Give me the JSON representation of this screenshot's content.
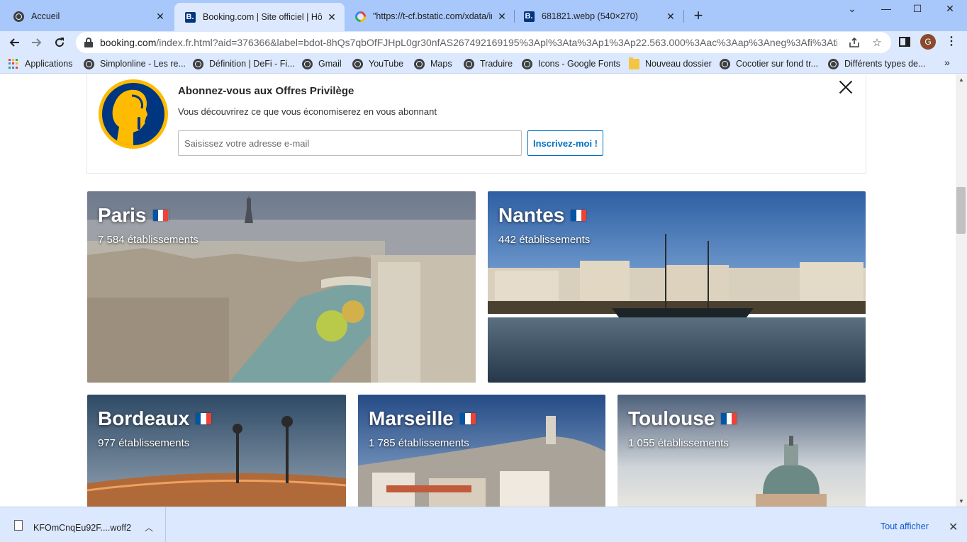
{
  "browser": {
    "tabs": [
      {
        "title": "Accueil",
        "favicon": "globe-icon"
      },
      {
        "title": "Booking.com | Site officiel | Hôtel",
        "favicon": "booking-icon"
      },
      {
        "title": "\"https://t-cf.bstatic.com/xdata/im",
        "favicon": "google-icon"
      },
      {
        "title": "681821.webp (540×270)",
        "favicon": "booking-icon"
      }
    ],
    "new_tab": "+",
    "window_controls": {
      "minimize": "—",
      "maximize": "☐",
      "close": "✕",
      "tab_search": "⌄"
    },
    "url_host": "booking.com",
    "url_rest": "/index.fr.html?aid=376366&label=bdot-8hQs7qbOfFJHpL0gr30nfAS267492169195%3Apl%3Ata%3Ap1%3Ap22.563.000%3Aac%3Aap%3Aneg%3Afi%3Atik...",
    "avatar_letter": "G",
    "bookmarks": [
      {
        "label": "Applications",
        "icon": "apps-grid-icon"
      },
      {
        "label": "Simplonline - Les re...",
        "icon": "globe-icon"
      },
      {
        "label": "Définition | DeFi - Fi...",
        "icon": "globe-icon"
      },
      {
        "label": "Gmail",
        "icon": "globe-icon"
      },
      {
        "label": "YouTube",
        "icon": "globe-icon"
      },
      {
        "label": "Maps",
        "icon": "globe-icon"
      },
      {
        "label": "Traduire",
        "icon": "globe-icon"
      },
      {
        "label": "Icons - Google Fonts",
        "icon": "globe-icon"
      },
      {
        "label": "Nouveau dossier",
        "icon": "folder-icon"
      },
      {
        "label": "Cocotier sur fond tr...",
        "icon": "globe-icon"
      },
      {
        "label": "Différents types de...",
        "icon": "globe-icon"
      }
    ],
    "bookmarks_more": "»"
  },
  "banner": {
    "title": "Abonnez-vous aux Offres Privilège",
    "subtitle": "Vous découvrirez ce que vous économiserez en vous abonnant",
    "email_placeholder": "Saisissez votre adresse e-mail",
    "button_label": "Inscrivez-moi !"
  },
  "destinations": [
    {
      "city": "Paris",
      "count": "7 584 établissements"
    },
    {
      "city": "Nantes",
      "count": "442 établissements"
    },
    {
      "city": "Bordeaux",
      "count": "977 établissements"
    },
    {
      "city": "Marseille",
      "count": "1 785 établissements"
    },
    {
      "city": "Toulouse",
      "count": "1 055 établissements"
    }
  ],
  "download_shelf": {
    "file_name": "KFOmCnqEu92F....woff2",
    "show_all": "Tout afficher"
  },
  "colors": {
    "booking_blue": "#003580",
    "booking_yellow": "#febb02",
    "link_blue": "#0071c2",
    "chrome_frame": "#a8c7fa"
  }
}
